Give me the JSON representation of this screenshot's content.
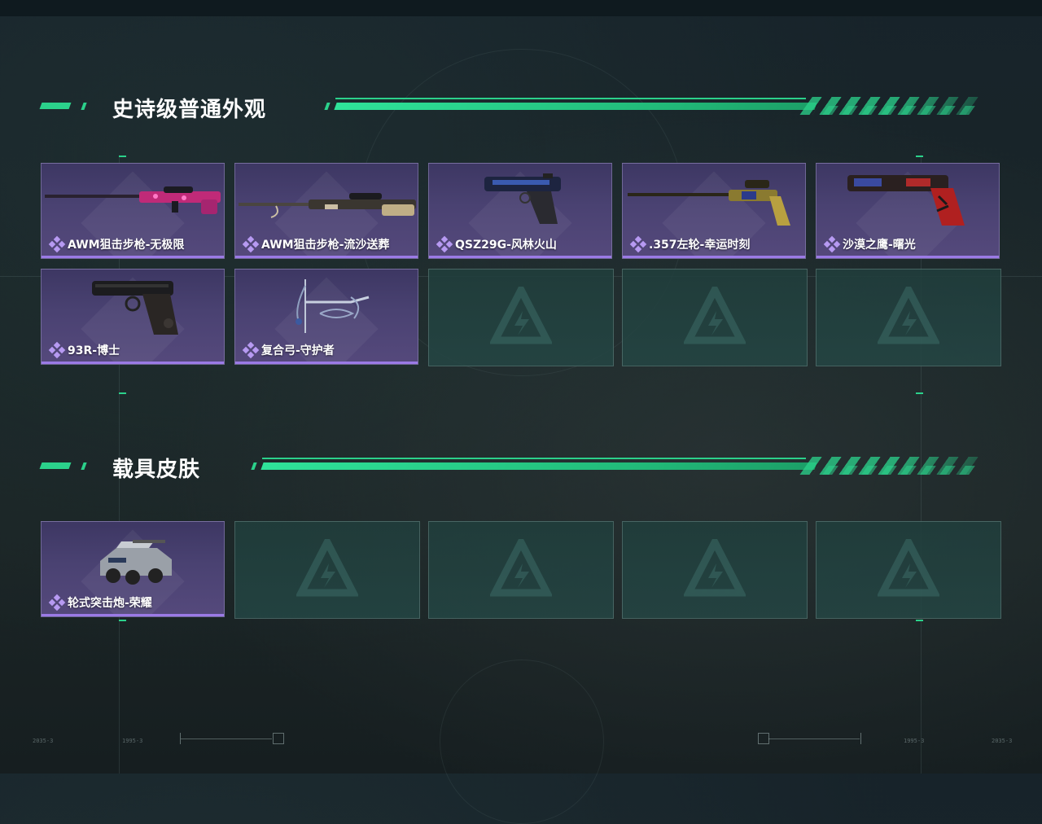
{
  "colors": {
    "accent_green": "#2bd18b",
    "epic_purple": "#9b7ae6",
    "card_bg": "#4a4272",
    "empty_slot_bg": "#24403f"
  },
  "sections": [
    {
      "title": "史诗级普通外观",
      "items": [
        {
          "name": "AWM狙击步枪-无极限",
          "icon": "sniper-rifle-pink-icon",
          "rarity": "epic"
        },
        {
          "name": "AWM狙击步枪-流沙送葬",
          "icon": "sniper-rifle-tan-icon",
          "rarity": "epic"
        },
        {
          "name": "QSZ29G-风林火山",
          "icon": "pistol-blue-icon",
          "rarity": "epic"
        },
        {
          "name": ".357左轮-幸运时刻",
          "icon": "revolver-gold-icon",
          "rarity": "epic"
        },
        {
          "name": "沙漠之鹰-曙光",
          "icon": "desert-eagle-red-icon",
          "rarity": "epic"
        },
        {
          "name": "93R-博士",
          "icon": "pistol-black-icon",
          "rarity": "epic"
        },
        {
          "name": "复合弓-守护者",
          "icon": "compound-bow-icon",
          "rarity": "epic"
        }
      ],
      "empty_slots": 3
    },
    {
      "title": "载具皮肤",
      "items": [
        {
          "name": "轮式突击炮-荣耀",
          "icon": "armored-vehicle-icon",
          "rarity": "epic"
        }
      ],
      "empty_slots": 4
    }
  ],
  "hud": {
    "bottom_labels": [
      "2035-3",
      "1995-3",
      "1995-3",
      "2035-3"
    ]
  }
}
